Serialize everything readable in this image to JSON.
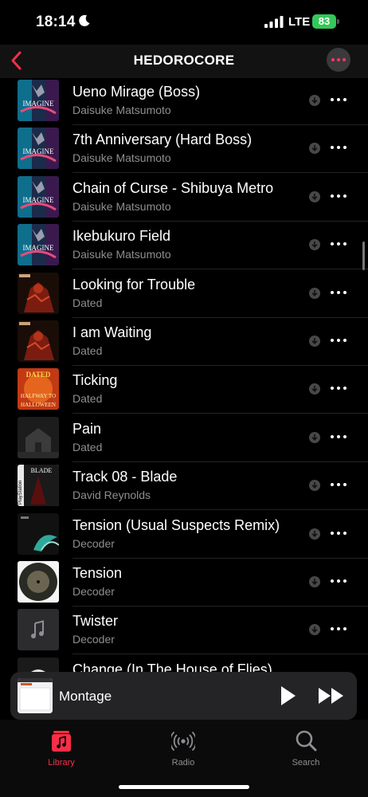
{
  "status_bar": {
    "time": "18:14",
    "network": "LTE",
    "battery": "83"
  },
  "nav": {
    "title": "HEDOROCORE"
  },
  "songs": [
    {
      "title": "Ueno Mirage (Boss)",
      "artist": "Daisuke Matsumoto",
      "art": "imagine"
    },
    {
      "title": "7th Anniversary (Hard Boss)",
      "artist": "Daisuke Matsumoto",
      "art": "imagine"
    },
    {
      "title": "Chain of Curse - Shibuya Metro",
      "artist": "Daisuke Matsumoto",
      "art": "imagine"
    },
    {
      "title": "Ikebukuro Field",
      "artist": "Daisuke Matsumoto",
      "art": "imagine"
    },
    {
      "title": "Looking for Trouble",
      "artist": "Dated",
      "art": "dated-red"
    },
    {
      "title": "I am Waiting",
      "artist": "Dated",
      "art": "dated-red"
    },
    {
      "title": "Ticking",
      "artist": "Dated",
      "art": "halloween"
    },
    {
      "title": "Pain",
      "artist": "Dated",
      "art": "dark-house"
    },
    {
      "title": "Track 08 - Blade",
      "artist": "David Reynolds",
      "art": "blade"
    },
    {
      "title": "Tension (Usual Suspects Remix)",
      "artist": "Decoder",
      "art": "decoder-green"
    },
    {
      "title": "Tension",
      "artist": "Decoder",
      "art": "vinyl"
    },
    {
      "title": "Twister",
      "artist": "Decoder",
      "art": "music-note-placeholder"
    },
    {
      "title": "Change (In The House of Flies)",
      "artist": "",
      "art": "white-figure"
    }
  ],
  "art_text": {
    "imagine_caption": "IMAGINE",
    "halloween_top": "DATED",
    "halloween_mid": "HALFWAY TO",
    "halloween_bottom": "HALLOWEEN",
    "blade_title": "BLADE",
    "blade_platform": "PlayStation"
  },
  "mini_player": {
    "title": "Montage"
  },
  "tabs": [
    {
      "label": "Library",
      "icon": "music-library-icon",
      "active": true
    },
    {
      "label": "Radio",
      "icon": "radio-broadcast-icon",
      "active": false
    },
    {
      "label": "Search",
      "icon": "magnifier-icon",
      "active": false
    }
  ],
  "colors": {
    "accent": "#fa2d48",
    "secondary_text": "#8e8e93",
    "battery": "#34c759",
    "mini_player_bg": "#242426"
  }
}
